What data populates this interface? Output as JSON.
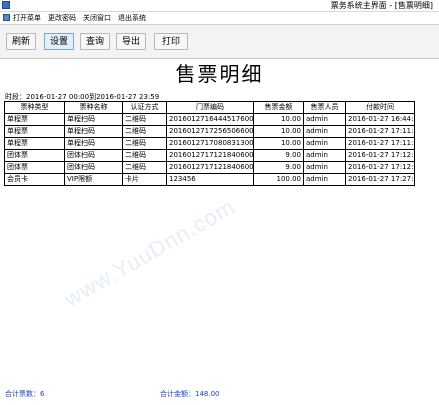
{
  "window": {
    "title": "票务系统主界面 - [售票明细]"
  },
  "menu": [
    "打开菜单",
    "更改密码",
    "关闭窗口",
    "退出系统"
  ],
  "toolbar": [
    "刷新",
    "设置",
    "查询",
    "导出",
    "打印"
  ],
  "report": {
    "title": "售票明细",
    "period": "时段：2016-01-27 00:00到2016-01-27 23:59",
    "columns": [
      "票种类型",
      "票种名称",
      "认证方式",
      "门票编码",
      "售票金额",
      "售票人员",
      "付款时间"
    ],
    "rows": [
      [
        "单程票",
        "单程扫码",
        "二维码",
        "20160127164445176001",
        "10.00",
        "admin",
        "2016-01-27 16:44:50"
      ],
      [
        "单程票",
        "单程扫码",
        "二维码",
        "20160127172565066001",
        "10.00",
        "admin",
        "2016-01-27 17:11:56"
      ],
      [
        "单程票",
        "单程扫码",
        "二维码",
        "20160127170808313001",
        "10.00",
        "admin",
        "2016-01-27 17:11:53"
      ],
      [
        "团体票",
        "团体扫码",
        "二维码",
        "20160127171218406001",
        "9.00",
        "admin",
        "2016-01-27 17:12:19"
      ],
      [
        "团体票",
        "团体扫码",
        "二维码",
        "20160127171218406002",
        "9.00",
        "admin",
        "2016-01-27 17:12:19"
      ],
      [
        "会员卡",
        "VIP限额",
        "卡片",
        "123456",
        "100.00",
        "admin",
        "2016-01-27 17:27:45"
      ]
    ]
  },
  "watermark": "www.YuuDnn.com",
  "footer": {
    "ticket_count": "合计票数：6",
    "amount_total": "合计金额：148.00"
  }
}
